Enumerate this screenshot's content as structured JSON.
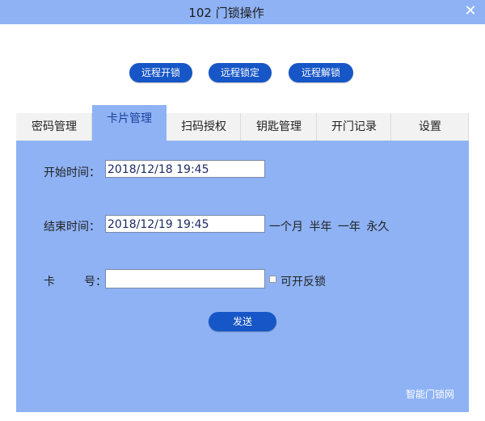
{
  "window": {
    "title": "102 门锁操作"
  },
  "actions": {
    "remote_open": "远程开锁",
    "remote_lock": "远程锁定",
    "remote_unlock": "远程解锁"
  },
  "tabs": [
    {
      "label": "密码管理",
      "active": false
    },
    {
      "label": "卡片管理",
      "active": true
    },
    {
      "label": "扫码授权",
      "active": false
    },
    {
      "label": "钥匙管理",
      "active": false
    },
    {
      "label": "开门记录",
      "active": false
    },
    {
      "label": "设置",
      "active": false
    }
  ],
  "form": {
    "start_label": "开始时间：",
    "start_value": "2018/12/18 19:45",
    "end_label": "结束时间：",
    "end_value": "2018/12/19 19:45",
    "presets": [
      "一个月",
      "半年",
      "一年",
      "永久"
    ],
    "card_label_left": "卡",
    "card_label_right": "号：",
    "card_value": "",
    "checkbox_label": "可开反锁",
    "send_label": "发送"
  },
  "watermark": {
    "text": "智能门锁网"
  },
  "colors": {
    "accent": "#8eb2f4",
    "button": "#1656c7"
  }
}
